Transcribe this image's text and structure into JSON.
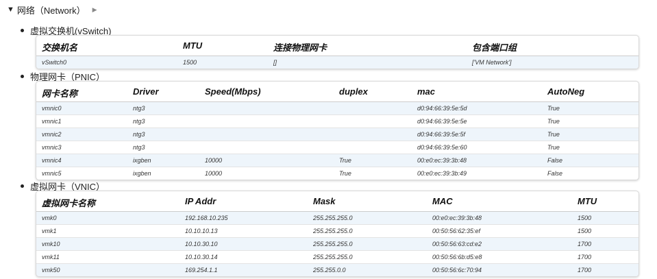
{
  "header": {
    "title": "网络（Network）"
  },
  "vswitch": {
    "title": "虚拟交换机(vSwitch)",
    "columns": [
      "交换机名",
      "MTU",
      "连接物理网卡",
      "包含端口组"
    ],
    "rows": [
      [
        "vSwitch0",
        "1500",
        "[]",
        "['VM Network']"
      ]
    ]
  },
  "pnic": {
    "title": "物理网卡（PNIC）",
    "columns": [
      "网卡名称",
      "Driver",
      "Speed(Mbps)",
      "duplex",
      "mac",
      "AutoNeg"
    ],
    "rows": [
      [
        "vmnic0",
        "ntg3",
        "",
        "",
        "d0:94:66:39:5e:5d",
        "True"
      ],
      [
        "vmnic1",
        "ntg3",
        "",
        "",
        "d0:94:66:39:5e:5e",
        "True"
      ],
      [
        "vmnic2",
        "ntg3",
        "",
        "",
        "d0:94:66:39:5e:5f",
        "True"
      ],
      [
        "vmnic3",
        "ntg3",
        "",
        "",
        "d0:94:66:39:5e:60",
        "True"
      ],
      [
        "vmnic4",
        "ixgben",
        "10000",
        "True",
        "00:e0:ec:39:3b:48",
        "False"
      ],
      [
        "vmnic5",
        "ixgben",
        "10000",
        "True",
        "00:e0:ec:39:3b:49",
        "False"
      ]
    ]
  },
  "vnic": {
    "title": "虚拟网卡（VNIC）",
    "columns": [
      "虚拟网卡名称",
      "IP Addr",
      "Mask",
      "MAC",
      "MTU"
    ],
    "rows": [
      [
        "vmk0",
        "192.168.10.235",
        "255.255.255.0",
        "00:e0:ec:39:3b:48",
        "1500"
      ],
      [
        "vmk1",
        "10.10.10.13",
        "255.255.255.0",
        "00:50:56:62:35:ef",
        "1500"
      ],
      [
        "vmk10",
        "10.10.30.10",
        "255.255.255.0",
        "00:50:56:63:cd:e2",
        "1700"
      ],
      [
        "vmk11",
        "10.10.30.14",
        "255.255.255.0",
        "00:50:56:6b:d5:e8",
        "1700"
      ],
      [
        "vmk50",
        "169.254.1.1",
        "255.255.0.0",
        "00:50:56:6c:70:94",
        "1700"
      ]
    ]
  },
  "chart_data": [
    {
      "type": "table",
      "columns": [
        "交换机名",
        "MTU",
        "连接物理网卡",
        "包含端口组"
      ],
      "rows": [
        [
          "vSwitch0",
          "1500",
          "[]",
          "['VM Network']"
        ]
      ]
    },
    {
      "type": "table",
      "columns": [
        "网卡名称",
        "Driver",
        "Speed(Mbps)",
        "duplex",
        "mac",
        "AutoNeg"
      ],
      "rows": [
        [
          "vmnic0",
          "ntg3",
          "",
          "",
          "d0:94:66:39:5e:5d",
          "True"
        ],
        [
          "vmnic1",
          "ntg3",
          "",
          "",
          "d0:94:66:39:5e:5e",
          "True"
        ],
        [
          "vmnic2",
          "ntg3",
          "",
          "",
          "d0:94:66:39:5e:5f",
          "True"
        ],
        [
          "vmnic3",
          "ntg3",
          "",
          "",
          "d0:94:66:39:5e:60",
          "True"
        ],
        [
          "vmnic4",
          "ixgben",
          "10000",
          "True",
          "00:e0:ec:39:3b:48",
          "False"
        ],
        [
          "vmnic5",
          "ixgben",
          "10000",
          "True",
          "00:e0:ec:39:3b:49",
          "False"
        ]
      ]
    },
    {
      "type": "table",
      "columns": [
        "虚拟网卡名称",
        "IP Addr",
        "Mask",
        "MAC",
        "MTU"
      ],
      "rows": [
        [
          "vmk0",
          "192.168.10.235",
          "255.255.255.0",
          "00:e0:ec:39:3b:48",
          "1500"
        ],
        [
          "vmk1",
          "10.10.10.13",
          "255.255.255.0",
          "00:50:56:62:35:ef",
          "1500"
        ],
        [
          "vmk10",
          "10.10.30.10",
          "255.255.255.0",
          "00:50:56:63:cd:e2",
          "1700"
        ],
        [
          "vmk11",
          "10.10.30.14",
          "255.255.255.0",
          "00:50:56:6b:d5:e8",
          "1700"
        ],
        [
          "vmk50",
          "169.254.1.1",
          "255.255.0.0",
          "00:50:56:6c:70:94",
          "1700"
        ]
      ]
    }
  ]
}
